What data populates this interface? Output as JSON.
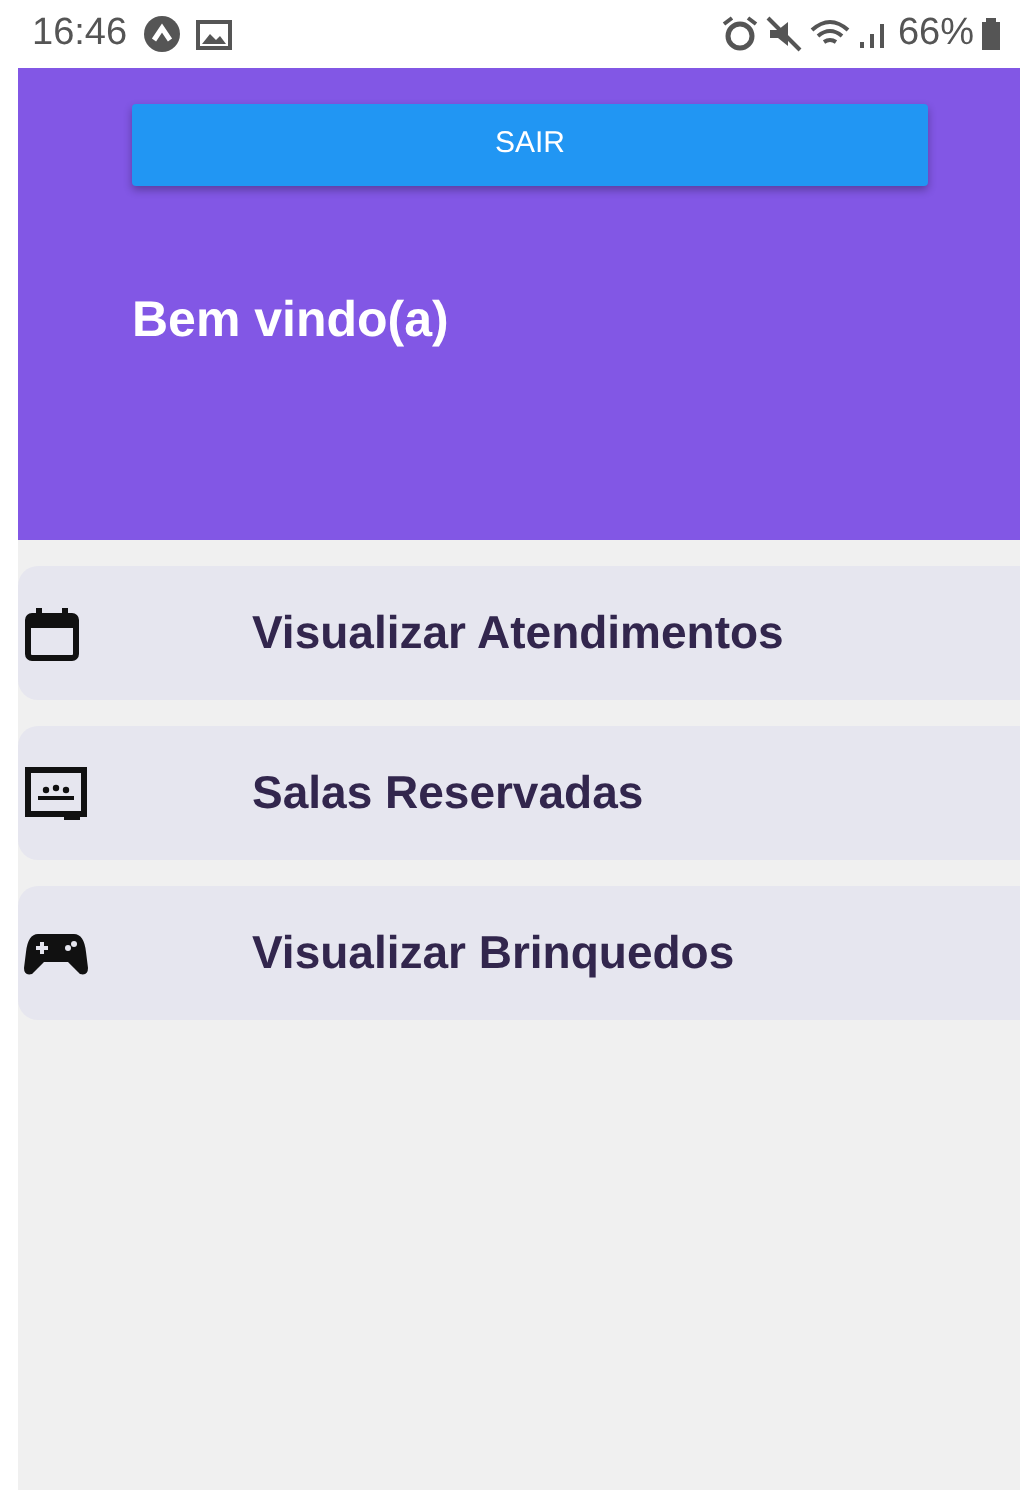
{
  "status_bar": {
    "time": "16:46",
    "battery": "66%"
  },
  "header": {
    "button": "SAIR",
    "title": "Bem vindo(a)"
  },
  "menu": [
    {
      "kind": "calendar",
      "label": "Visualizar Atendimentos"
    },
    {
      "kind": "classroom",
      "label": "Salas Reservadas"
    },
    {
      "kind": "gamepad",
      "label": "Visualizar Brinquedos"
    }
  ]
}
